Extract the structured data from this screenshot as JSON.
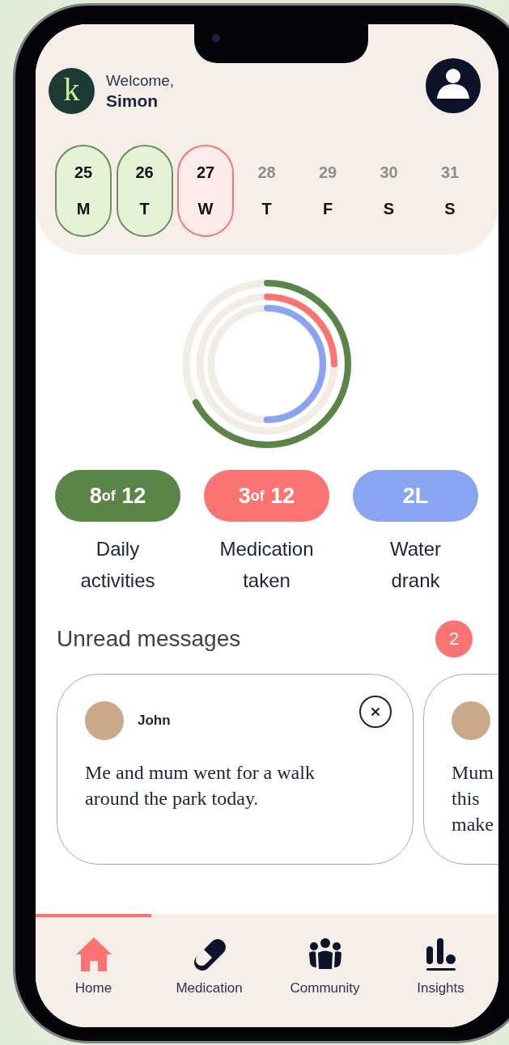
{
  "header": {
    "logo": "k",
    "welcome": "Welcome,",
    "name": "Simon"
  },
  "days": [
    {
      "date": "25",
      "day": "M",
      "completed": true,
      "selected": false
    },
    {
      "date": "26",
      "day": "T",
      "completed": true,
      "selected": false
    },
    {
      "date": "27",
      "day": "W",
      "completed": false,
      "selected": true
    },
    {
      "date": "28",
      "day": "T",
      "completed": false,
      "selected": false
    },
    {
      "date": "29",
      "day": "F",
      "completed": false,
      "selected": false
    },
    {
      "date": "30",
      "day": "S",
      "completed": false,
      "selected": false
    },
    {
      "date": "31",
      "day": "S",
      "completed": false,
      "selected": false
    }
  ],
  "rings": [
    {
      "color": "#5a8448",
      "level": 0.67
    },
    {
      "color": "#fb7373",
      "level": 0.25
    },
    {
      "color": "#8aa4f2",
      "level": 0.5
    }
  ],
  "stats": [
    {
      "count": "8",
      "of": "of",
      "total": "12",
      "label": "Daily\nactivities",
      "color": "#5a8448"
    },
    {
      "count": "3",
      "of": "of",
      "total": "12",
      "label": "Medication\ntaken",
      "color": "#fb7373"
    },
    {
      "count": "2L",
      "label": "Water\ndrank",
      "color": "#8aa4f2"
    }
  ],
  "messages": {
    "title": "Unread messages",
    "count": "2",
    "items": [
      {
        "sender": "John",
        "text": "Me and mum went for a walk around the park today.",
        "dismissible": true
      },
      {
        "text": "Mum\nthis\nmake",
        "dismissible": false
      }
    ]
  },
  "nav": [
    {
      "label": "Home",
      "selected": true
    },
    {
      "label": "Medication",
      "selected": false
    },
    {
      "label": "Community",
      "selected": false
    },
    {
      "label": "Insights",
      "selected": false
    }
  ]
}
